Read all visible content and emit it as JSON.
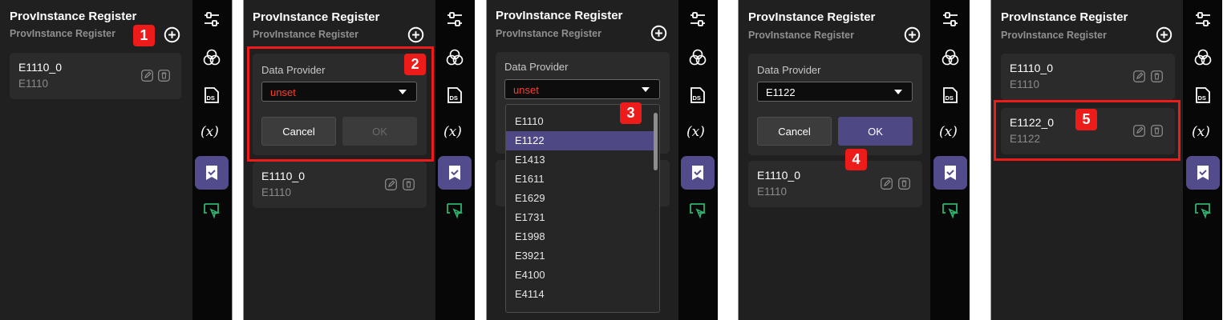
{
  "app": {
    "title": "ProvInstance Register",
    "subtitle": "ProvInstance Register"
  },
  "form": {
    "field_label": "Data Provider",
    "cancel_label": "Cancel",
    "ok_label": "OK"
  },
  "select_values": {
    "unset": "unset",
    "chosen": "E1122"
  },
  "dropdown_options": [
    "E1110",
    "E1122",
    "E1413",
    "E1611",
    "E1629",
    "E1731",
    "E1998",
    "E3921",
    "E4100",
    "E4114"
  ],
  "instances": {
    "first": {
      "name": "E1110_0",
      "provider": "E1110"
    },
    "second": {
      "name": "E1122_0",
      "provider": "E1122"
    }
  },
  "steps": [
    "1",
    "2",
    "3",
    "4",
    "5"
  ],
  "rail_icons": [
    "sliders-icon",
    "color-circles-icon",
    "ds-document-icon",
    "variable-x-icon",
    "bookmark-check-icon",
    "cursor-comment-icon"
  ],
  "colors": {
    "background": "#202020",
    "rail": "#070707",
    "card": "#2b2b2b",
    "accent": "#524c8c",
    "highlight": "#ee1b1b",
    "unset_text": "#ff3b30",
    "rail_green": "#2fb26e"
  }
}
